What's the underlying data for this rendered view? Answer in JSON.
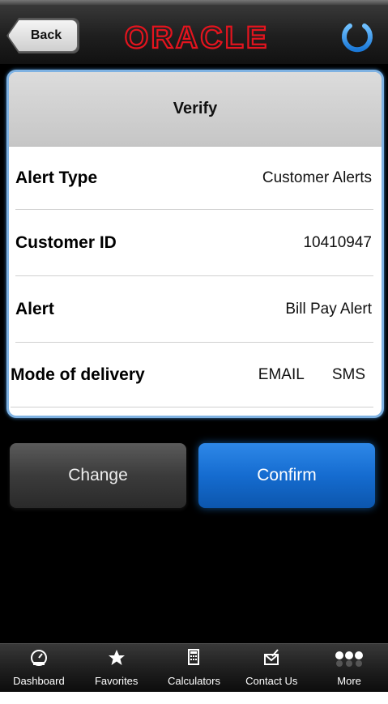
{
  "header": {
    "back_label": "Back",
    "logo_text": "ORACLE",
    "brand_color": "#e4141e",
    "power_icon": "power-icon"
  },
  "card": {
    "title": "Verify",
    "rows": [
      {
        "label": "Alert Type",
        "value": "Customer Alerts"
      },
      {
        "label": "Customer ID",
        "value": "10410947"
      },
      {
        "label": "Alert",
        "value": "Bill Pay Alert"
      }
    ],
    "delivery": {
      "label": "Mode of delivery",
      "options": [
        "EMAIL",
        "SMS"
      ]
    }
  },
  "actions": {
    "change_label": "Change",
    "confirm_label": "Confirm",
    "confirm_color": "#1a6fd2"
  },
  "tabbar": {
    "items": [
      {
        "label": "Dashboard",
        "icon": "dashboard-gauge-icon"
      },
      {
        "label": "Favorites",
        "icon": "star-icon"
      },
      {
        "label": "Calculators",
        "icon": "calculator-icon"
      },
      {
        "label": "Contact Us",
        "icon": "envelope-icon"
      },
      {
        "label": "More",
        "icon": "more-dots-icon"
      }
    ]
  }
}
